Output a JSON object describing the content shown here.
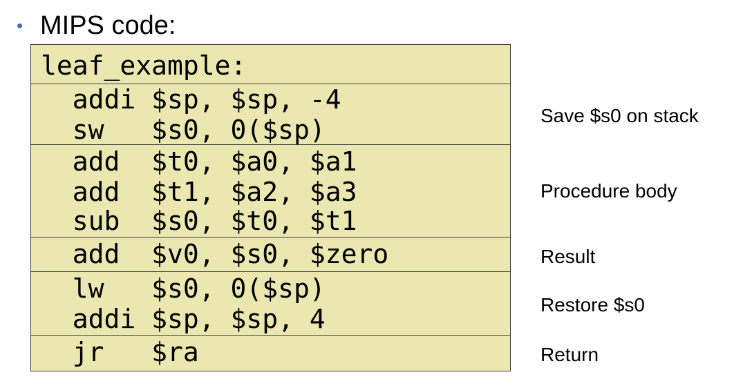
{
  "heading": {
    "bullet": "•",
    "title": "MIPS code:"
  },
  "code": {
    "label_line": "leaf_example:",
    "sections": [
      {
        "lines": [
          "  addi $sp, $sp, -4",
          "  sw   $s0, 0($sp)"
        ],
        "comment": "Save $s0 on stack"
      },
      {
        "lines": [
          "  add  $t0, $a0, $a1",
          "  add  $t1, $a2, $a3",
          "  sub  $s0, $t0, $t1"
        ],
        "comment": "Procedure body"
      },
      {
        "lines": [
          "  add  $v0, $s0, $zero"
        ],
        "comment": "Result"
      },
      {
        "lines": [
          "  lw   $s0, 0($sp)",
          "  addi $sp, $sp, 4"
        ],
        "comment": "Restore $s0"
      },
      {
        "lines": [
          "  jr   $ra"
        ],
        "comment": "Return"
      }
    ]
  },
  "colors": {
    "code_background": "#eae7b0",
    "border": "#3a3a3a",
    "bullet": "#4a6bb4"
  }
}
